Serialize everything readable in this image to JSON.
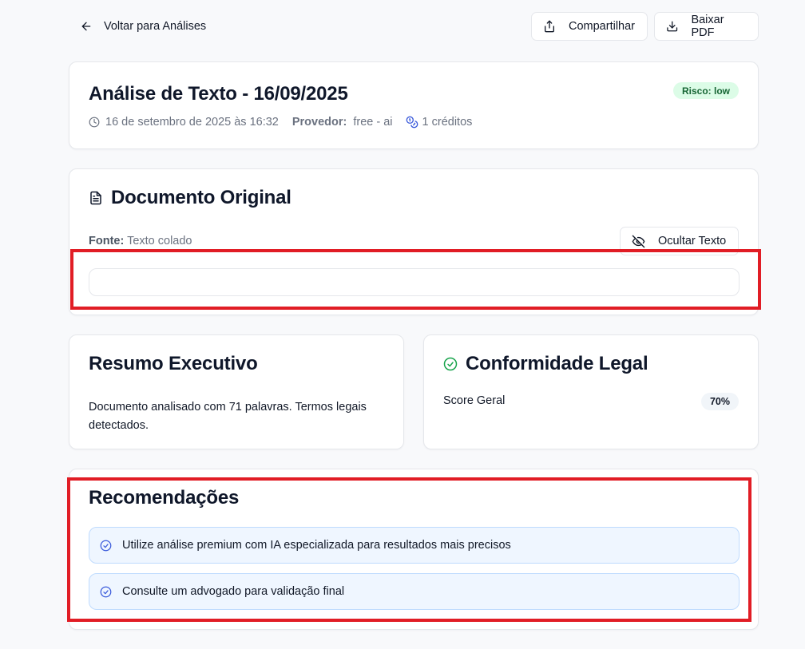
{
  "header": {
    "back_label": "Voltar para Análises",
    "share_label": "Compartilhar",
    "pdf_label": "Baixar PDF"
  },
  "analysis": {
    "title": "Análise de Texto - 16/09/2025",
    "risk_badge": "Risco: low",
    "date_text": "16 de setembro de 2025 às 16:32",
    "provider_label": "Provedor:",
    "provider_value": "free - ai",
    "credits": "1 créditos"
  },
  "document": {
    "title": "Documento Original",
    "source_label": "Fonte:",
    "source_value": "Texto colado",
    "hide_button_label": "Ocultar Texto",
    "text_content": ""
  },
  "summary": {
    "title": "Resumo Executivo",
    "text": "Documento analisado com 71 palavras. Termos legais detectados."
  },
  "compliance": {
    "title": "Conformidade Legal",
    "score_label": "Score Geral",
    "score_value": "70%"
  },
  "recommendations": {
    "title": "Recomendações",
    "items": [
      {
        "text": "Utilize análise premium com IA especializada para resultados mais precisos"
      },
      {
        "text": "Consulte um advogado para validação final"
      }
    ]
  },
  "colors": {
    "page_bg": "#f8f9fb",
    "risk_badge_bg": "#dcfce7",
    "risk_badge_text": "#166534",
    "accent_blue": "#3b5bdb",
    "check_green": "#16a34a",
    "recommendation_bg": "#eff6ff",
    "highlight_red": "#e11d25"
  },
  "icons": {
    "back": "arrow-left-icon",
    "share": "share-upload-icon",
    "download": "download-icon",
    "clock": "clock-icon",
    "credits": "coins-icon",
    "document": "file-text-icon",
    "hide": "eye-off-icon",
    "compliance": "check-circle-icon",
    "recommendation": "check-circle-icon"
  }
}
